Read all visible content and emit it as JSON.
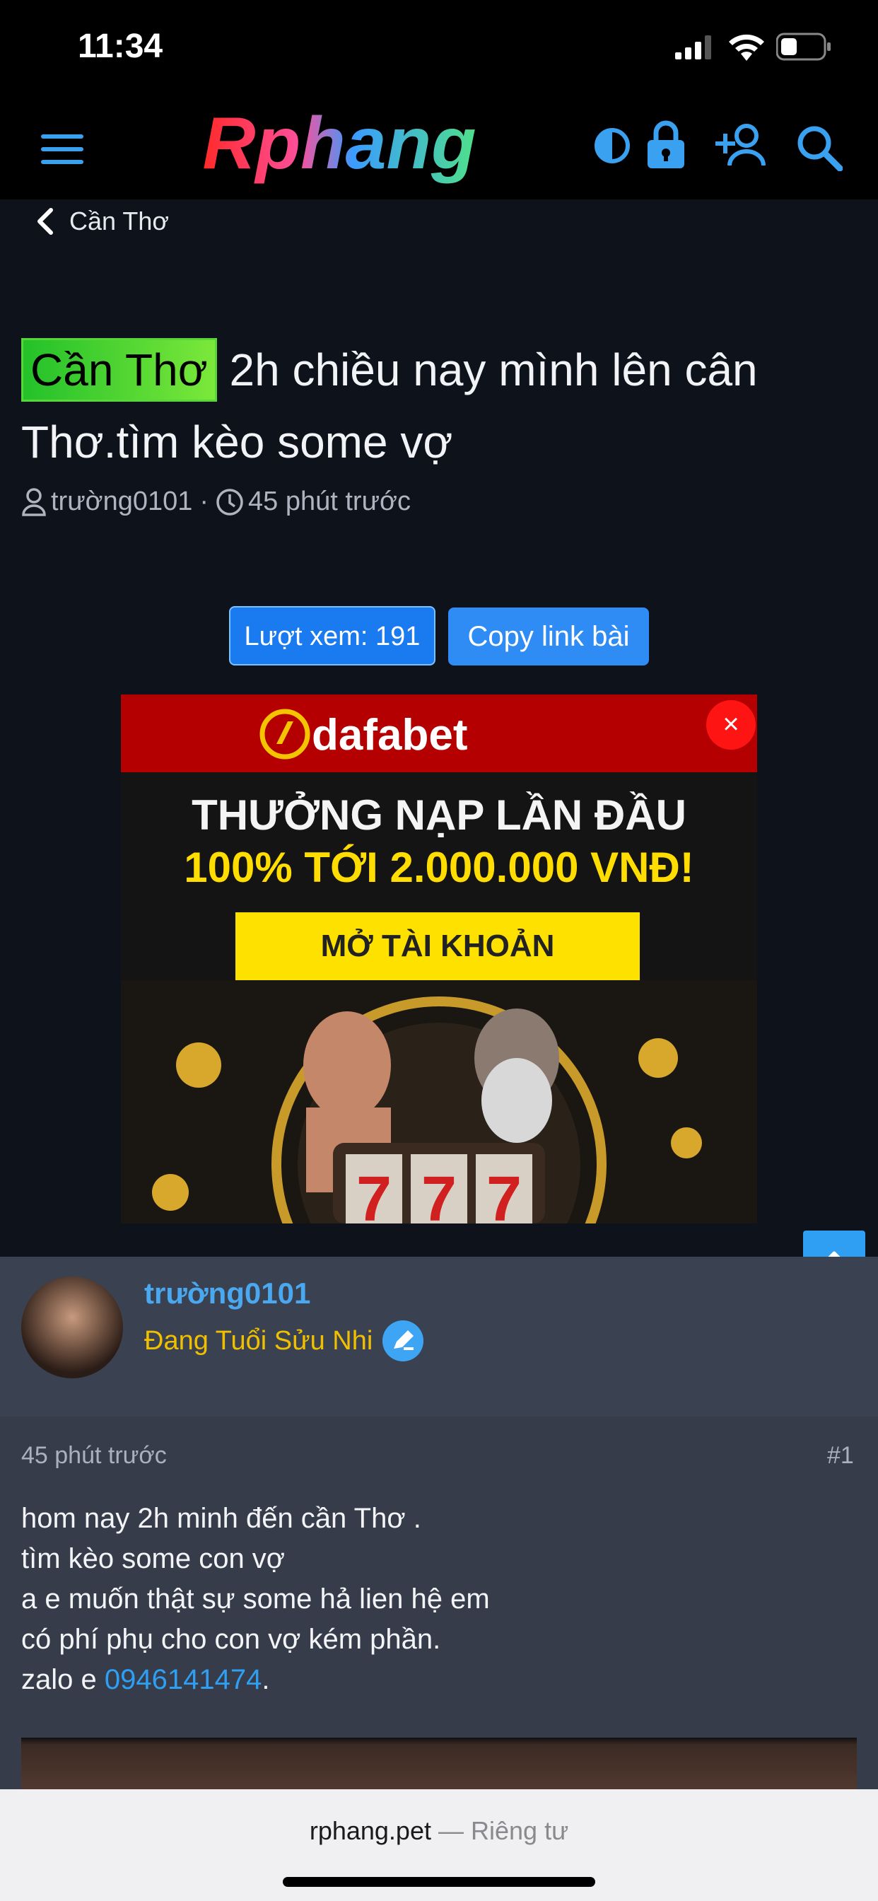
{
  "status_bar": {
    "time": "11:34"
  },
  "header": {
    "logo_text": "Rphang"
  },
  "breadcrumb": {
    "label": "Cần Thơ"
  },
  "thread": {
    "tag": "Cần Thơ",
    "title": " 2h chiều nay mình lên cân Thơ.tìm kèo some vợ",
    "author": "trường0101",
    "time": "45 phút trước"
  },
  "buttons": {
    "views": "Lượt xem: 191",
    "copy_link": "Copy link bài"
  },
  "ad": {
    "brand": "dafabet",
    "close": "×",
    "headline": "THƯỞNG NẠP LẦN ĐẦU",
    "offer": "100% TỚI 2.000.000 VNĐ!",
    "cta": "MỞ TÀI KHOẢN"
  },
  "post": {
    "author_name": "trường0101",
    "author_rank": "Đang Tuổi Sửu Nhi",
    "time": "45 phút trước",
    "number": "#1",
    "lines": [
      "hom nay 2h minh đến cần Thơ .",
      "tìm kèo some con vợ",
      "a e muốn thật sự some hả lien hệ em",
      "có phí phụ cho con vợ kém phần."
    ],
    "zalo_prefix": "zalo e ",
    "phone": "0946141474",
    "zalo_suffix": "."
  },
  "browser": {
    "domain": "rphang.pet",
    "separator": " — ",
    "private_label": "Riêng tư"
  },
  "colors": {
    "accent": "#2f9ff3",
    "rank": "#f0c000",
    "ad_red": "#b40000"
  }
}
